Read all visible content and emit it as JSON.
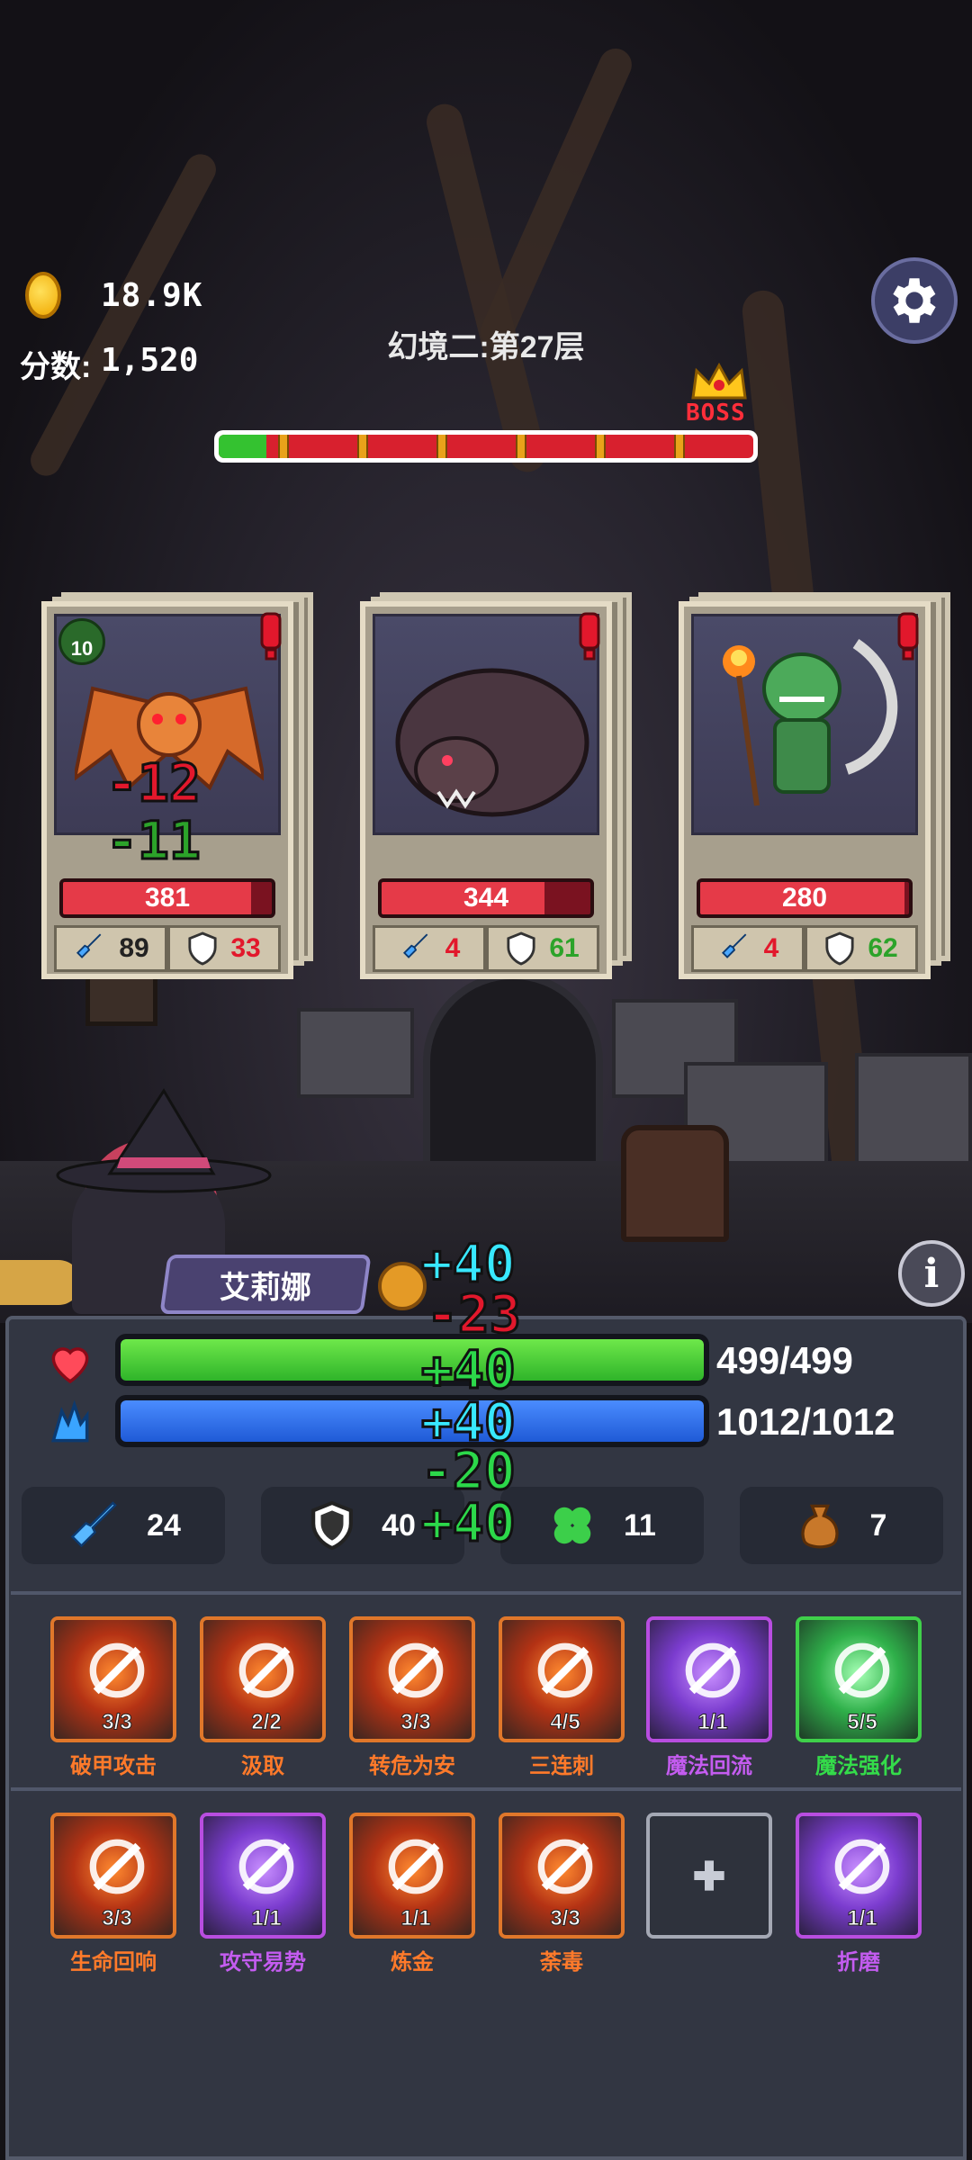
{
  "hud": {
    "coins": "18.9K",
    "score_label": "分数:",
    "score_value": "1,520",
    "stage_title": "幻境二:第27层",
    "boss_label": "BOSS",
    "progress_fraction": 0.09
  },
  "enemies": [
    {
      "name": "bat-demon",
      "hp": "381",
      "hp_fraction": 0.9,
      "attack": "89",
      "defense": "33",
      "attack_color": "#222222",
      "defense_color": "#e2182c",
      "badge": "10"
    },
    {
      "name": "shadow-beast",
      "hp": "344",
      "hp_fraction": 0.78,
      "attack": "4",
      "defense": "61",
      "attack_color": "#e2182c",
      "defense_color": "#2ca32a"
    },
    {
      "name": "goblin-shaman",
      "hp": "280",
      "hp_fraction": 0.98,
      "attack": "4",
      "defense": "62",
      "attack_color": "#e2182c",
      "defense_color": "#2ca32a"
    }
  ],
  "floating_damage": {
    "enemy": [
      "-12",
      "-11"
    ],
    "hero": [
      "+40",
      "-23",
      "+40",
      "+40",
      "-20",
      "+40"
    ]
  },
  "hero": {
    "name": "艾莉娜",
    "hp": "499/499",
    "hp_fraction": 1.0,
    "mp": "1012/1012",
    "mp_fraction": 1.0,
    "stats": {
      "attack": "24",
      "defense": "40",
      "luck": "11",
      "bag": "7"
    }
  },
  "skills_row1": [
    {
      "name": "破甲攻击",
      "level": "3/3",
      "theme": "orange",
      "icon": "armor-break-icon"
    },
    {
      "name": "汲取",
      "level": "2/2",
      "theme": "orange",
      "icon": "drain-icon"
    },
    {
      "name": "转危为安",
      "level": "3/3",
      "theme": "orange",
      "icon": "reversal-icon"
    },
    {
      "name": "三连刺",
      "level": "4/5",
      "theme": "orange",
      "icon": "triple-stab-icon"
    },
    {
      "name": "魔法回流",
      "level": "1/1",
      "theme": "purple",
      "icon": "magic-backflow-icon"
    },
    {
      "name": "魔法强化",
      "level": "5/5",
      "theme": "green",
      "icon": "magic-boost-icon"
    }
  ],
  "skills_row2": [
    {
      "name": "生命回响",
      "level": "3/3",
      "theme": "orange",
      "icon": "life-echo-icon"
    },
    {
      "name": "攻守易势",
      "level": "1/1",
      "theme": "purple",
      "icon": "stance-swap-icon"
    },
    {
      "name": "炼金",
      "level": "1/1",
      "theme": "orange",
      "icon": "alchemy-icon"
    },
    {
      "name": "荼毒",
      "level": "3/3",
      "theme": "orange",
      "icon": "poison-icon"
    },
    {
      "name": "折磨",
      "level": "1/1",
      "theme": "purple",
      "icon": "torment-icon"
    }
  ],
  "colors": {
    "hp_green": "#3fcf3a",
    "mp_blue": "#2b6ee8",
    "danger_red": "#e2182c",
    "buff_green": "#2ca32a"
  }
}
